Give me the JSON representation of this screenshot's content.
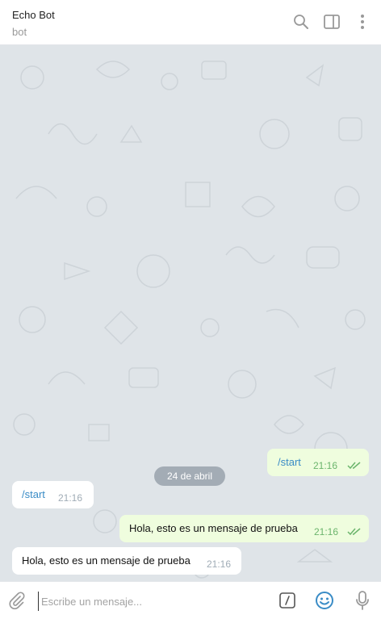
{
  "header": {
    "title": "Echo Bot",
    "subtitle": "bot",
    "icons": [
      "search-icon",
      "sidebar-toggle-icon",
      "more-vertical-icon"
    ]
  },
  "chat": {
    "date_label": "24 de abril",
    "messages": [
      {
        "direction": "out",
        "text": "/start",
        "time": "21:16",
        "status": "read"
      },
      {
        "direction": "in",
        "text": "/start",
        "time": "21:16"
      },
      {
        "direction": "out",
        "text": "Hola, esto es un mensaje de prueba",
        "time": "21:16",
        "status": "read"
      },
      {
        "direction": "in",
        "text": "Hola, esto es un mensaje de prueba",
        "time": "21:16"
      }
    ]
  },
  "composer": {
    "placeholder": "Escribe un mensaje...",
    "value": "",
    "icons": [
      "attach-icon",
      "bot-command-icon",
      "emoji-icon",
      "microphone-icon"
    ]
  },
  "colors": {
    "chat_background": "#dfe4e8",
    "outgoing_bubble": "#effdde",
    "incoming_bubble": "#ffffff",
    "command_link": "#3a8cc6",
    "read_check": "#6cb56d",
    "accent": "#3a8cc6"
  }
}
